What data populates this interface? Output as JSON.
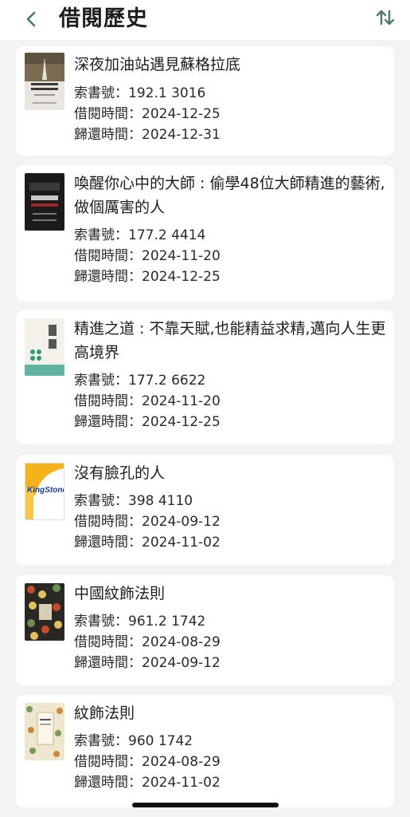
{
  "header": {
    "title": "借閱歷史",
    "back_icon": "chevron-left-icon",
    "sort_icon": "sort-arrows-icon",
    "accent": "#4a7a60"
  },
  "labels": {
    "call_number": "索書號：",
    "borrow_date": "借閱時間：",
    "return_date": "歸還時間："
  },
  "books": [
    {
      "title": "深夜加油站遇見蘇格拉底",
      "call_number": "192.1 3016",
      "borrow_date": "2024-12-25",
      "return_date": "2024-12-31"
    },
    {
      "title": "喚醒你心中的大師 : 偷學48位大師精進的藝術,做個厲害的人",
      "call_number": "177.2 4414",
      "borrow_date": "2024-11-20",
      "return_date": "2024-12-25"
    },
    {
      "title": "精進之道 : 不靠天賦,也能精益求精,邁向人生更高境界",
      "call_number": "177.2 6622",
      "borrow_date": "2024-11-20",
      "return_date": "2024-12-25"
    },
    {
      "title": "沒有臉孔的人",
      "call_number": "398 4110",
      "borrow_date": "2024-09-12",
      "return_date": "2024-11-02",
      "cover_text": "KingStone"
    },
    {
      "title": "中國紋飾法則",
      "call_number": "961.2 1742",
      "borrow_date": "2024-08-29",
      "return_date": "2024-09-12"
    },
    {
      "title": "紋飾法則",
      "call_number": "960 1742",
      "borrow_date": "2024-08-29",
      "return_date": "2024-11-02"
    }
  ]
}
